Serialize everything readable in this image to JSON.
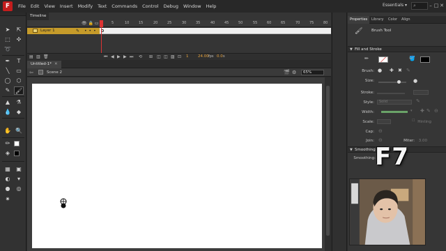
{
  "menubar": {
    "logo": "F",
    "items": [
      "File",
      "Edit",
      "View",
      "Insert",
      "Modify",
      "Text",
      "Commands",
      "Control",
      "Debug",
      "Window",
      "Help"
    ],
    "workspace": "Essentials",
    "window_buttons": [
      "–",
      "□",
      "✕"
    ]
  },
  "timeline": {
    "tab_label": "Timeline",
    "frame_numbers": [
      "1",
      "5",
      "10",
      "15",
      "20",
      "25",
      "30",
      "35",
      "40",
      "45",
      "50",
      "55",
      "60",
      "65",
      "70",
      "75",
      "80"
    ],
    "layer_name": "Layer 1",
    "current_frame": "1",
    "fps": "24.00",
    "fps_unit": "fps",
    "time": "0.0",
    "time_unit": "s"
  },
  "document": {
    "tab_label": "Untitled-1*",
    "scene": "Scene 2",
    "zoom": "65%"
  },
  "properties": {
    "tabs": [
      "Properties",
      "Library",
      "Color",
      "Align"
    ],
    "tool_name": "Brush Tool",
    "fill_stroke_header": "Fill and Stroke",
    "labels": {
      "brush": "Brush:",
      "size": "Size:",
      "stroke": "Stroke:",
      "style": "Style:",
      "width": "Width:",
      "scale": "Scale:",
      "cap": "Cap:",
      "join": "Join:",
      "miter": "Miter:"
    },
    "style_value": "Solid",
    "scale_value": "Hinting",
    "miter_value": "3.00",
    "smoothing_header": "Smoothing",
    "smoothing_label": "Smoothing:"
  },
  "overlay": {
    "key": "F7"
  },
  "colors": {
    "layer_highlight": "#c69b2a",
    "playhead": "#dd3333",
    "stage": "#ffffff",
    "width_bar": "#6aa368"
  }
}
